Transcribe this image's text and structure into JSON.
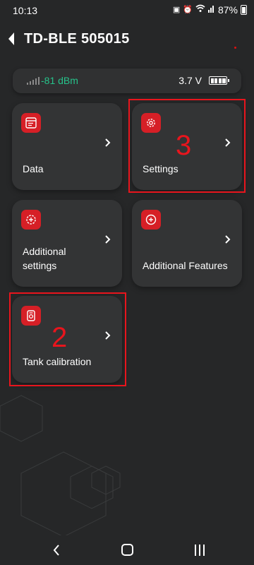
{
  "status_bar": {
    "time": "10:13",
    "battery": "87%"
  },
  "header": {
    "title": "TD-BLE 505015"
  },
  "signal": {
    "rssi": "-81 dBm",
    "voltage": "3.7 V"
  },
  "tiles": [
    {
      "label": "Data",
      "icon": "document-icon"
    },
    {
      "label": "Settings",
      "icon": "gear-icon"
    },
    {
      "label": "Additional settings",
      "icon": "gear-plus-icon"
    },
    {
      "label": "Additional Features",
      "icon": "plus-circle-icon"
    },
    {
      "label": "Tank calibration",
      "icon": "tank-icon"
    }
  ],
  "annotations": {
    "settings_number": "3",
    "tank_number": "2"
  },
  "colors": {
    "accent": "#d61f26",
    "signal_text": "#26c28a",
    "annotation": "#e8151d",
    "background": "#262728",
    "tile": "#333435"
  }
}
